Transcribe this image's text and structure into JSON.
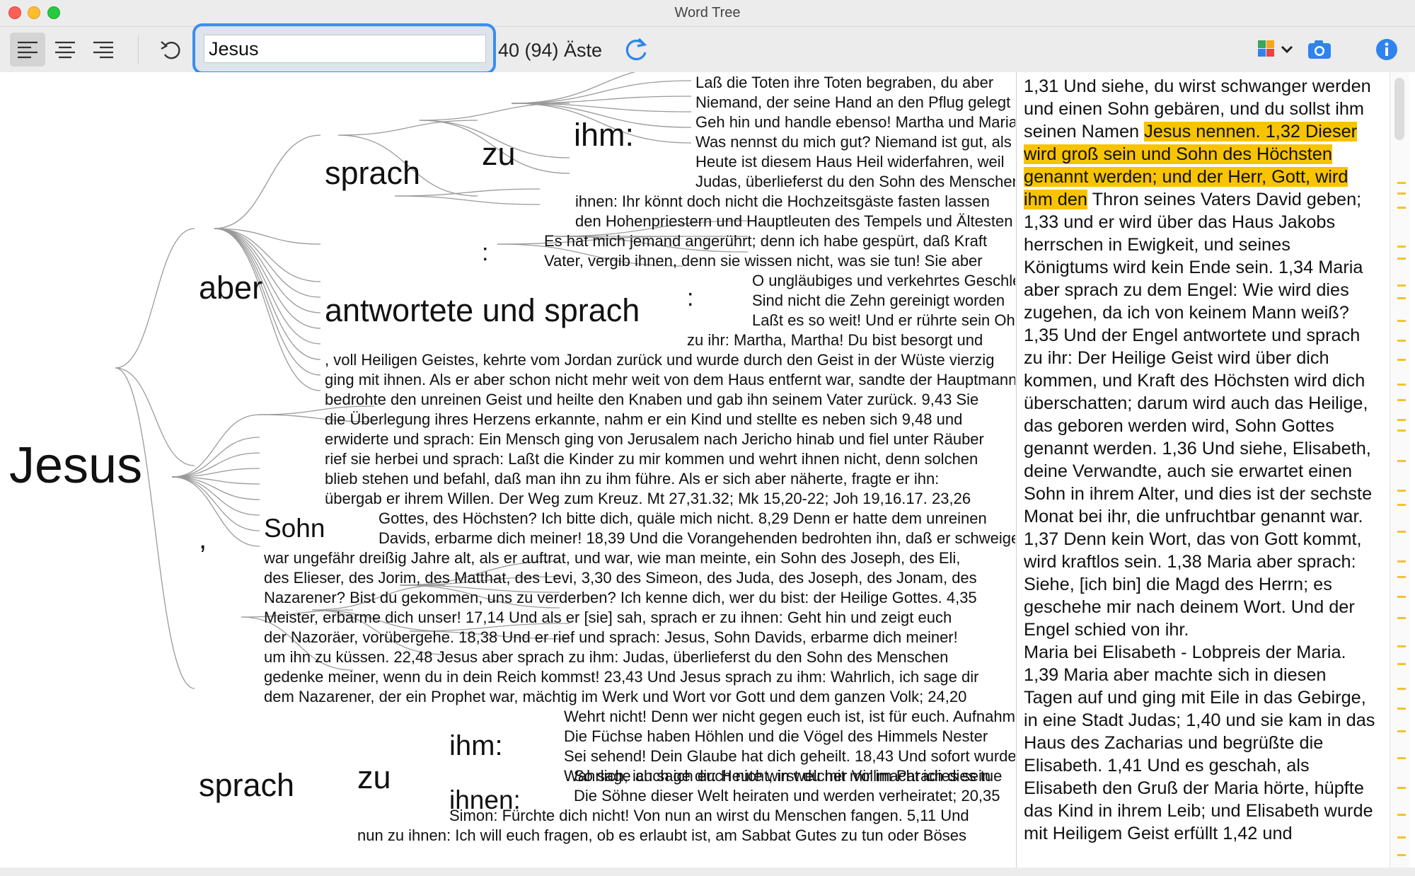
{
  "window": {
    "title": "Word Tree"
  },
  "toolbar": {
    "align_left": "align-left",
    "align_center": "align-center",
    "align_right": "align-right",
    "undo": "undo",
    "search_value": "Jesus",
    "branch_count": "40 (94) Äste",
    "refresh": "refresh",
    "palette": "color-palette",
    "screenshot": "camera",
    "info": "info"
  },
  "tree": {
    "root": "Jesus",
    "aber": "aber",
    "sprach_a": "sprach",
    "zu_a": "zu",
    "ihm_a": "ihm:",
    "colon_a": ":",
    "antw": "antwortete und sprach",
    "colon_b": ":",
    "comma": ",",
    "sohn": "Sohn",
    "sprach_b": "sprach",
    "zu_b": "zu",
    "ihm_b": "ihm:",
    "ihnen_b": "ihnen:",
    "g1": [
      "Laß die Toten ihre Toten begraben, du aber",
      "Niemand, der seine Hand an den Pflug gelegt",
      "Geh hin und handle ebenso! Martha und Maria",
      "Was nennst du mich gut? Niemand ist gut, als",
      "Heute ist diesem Haus Heil widerfahren, weil",
      "Judas, überlieferst du den Sohn des Menschen"
    ],
    "g2": [
      "ihnen: Ihr könnt doch nicht die Hochzeitsgäste fasten lassen",
      "den Hohenpriestern und Hauptleuten des Tempels und Ältesten"
    ],
    "g3": [
      "Es hat mich jemand angerührt; denn ich habe gespürt, daß Kraft",
      "Vater, vergib ihnen, denn sie wissen nicht, was sie tun! Sie aber"
    ],
    "g4": [
      "O ungläubiges und verkehrtes Geschlecht",
      "Sind nicht die Zehn gereinigt worden",
      "Laßt es so weit! Und er rührte sein Ohr"
    ],
    "g5": "zu ihr: Martha, Martha! Du bist besorgt und",
    "g6": [
      ", voll Heiligen Geistes, kehrte vom Jordan zurück und wurde durch den Geist in der Wüste vierzig",
      "ging mit ihnen. Als er aber schon nicht mehr weit von dem Haus entfernt war, sandte der Hauptmann",
      "bedrohte den unreinen Geist und heilte den Knaben und gab ihn seinem Vater zurück. 9,43 Sie",
      "die Überlegung ihres Herzens erkannte, nahm er ein Kind und stellte es neben sich 9,48 und",
      "erwiderte und sprach: Ein Mensch ging von Jerusalem nach Jericho hinab und fiel unter Räuber",
      "rief sie herbei und sprach: Laßt die Kinder zu mir kommen und wehrt ihnen nicht, denn solchen",
      "blieb stehen und befahl, daß man ihn zu ihm führe. Als er sich aber näherte, fragte er ihn:",
      "übergab er ihrem Willen. Der Weg zum Kreuz. Mt 27,31.32; Mk 15,20-22; Joh 19,16.17. 23,26"
    ],
    "g7": [
      "Gottes, des Höchsten? Ich bitte dich, quäle mich nicht. 8,29 Denn er hatte dem unreinen",
      "Davids, erbarme dich meiner! 18,39 Und die Vorangehenden bedrohten ihn, daß er schweige"
    ],
    "g8": [
      "war ungefähr dreißig Jahre alt, als er auftrat, und war, wie man meinte, ein Sohn des Joseph, des Eli,",
      "des Elieser, des Jorim, des Matthat, des Levi, 3,30 des Simeon, des Juda, des Joseph, des Jonam, des",
      "Nazarener? Bist du gekommen, uns zu verderben? Ich kenne dich, wer du bist: der Heilige Gottes. 4,35",
      "Meister, erbarme dich unser! 17,14 Und als er [sie] sah, sprach er zu ihnen: Geht hin und zeigt euch",
      "der Nazoräer, vorübergehe. 18,38 Und er rief und sprach: Jesus, Sohn Davids, erbarme dich meiner!",
      "um ihn zu küssen. 22,48 Jesus aber sprach zu ihm: Judas, überlieferst du den Sohn des Menschen",
      "gedenke meiner, wenn du in dein Reich kommst! 23,43 Und Jesus sprach zu ihm: Wahrlich, ich sage dir",
      "dem Nazarener, der ein Prophet war, mächtig im Werk und Wort vor Gott und dem ganzen Volk; 24,20"
    ],
    "g9": [
      "Wehrt nicht! Denn wer nicht gegen euch ist, ist für euch. Aufnahme",
      "Die Füchse haben Höhlen und die Vögel des Himmels Nester",
      "Sei sehend! Dein Glaube hat dich geheilt. 18,43 Und sofort wurde",
      "Wahrlich, ich sage dir: Heute wirst du mit mir im Paradies sein"
    ],
    "g10": [
      "So sage auch ich euch nicht, in welcher Vollmacht ich dies tue",
      "Die Söhne dieser Welt heiraten und werden verheiratet; 20,35"
    ],
    "g11": "Simon: Fürchte dich nicht! Von nun an wirst du Menschen fangen. 5,11 Und",
    "g12": "nun zu ihnen: Ich will euch fragen, ob es erlaubt ist, am Sabbat Gutes zu tun oder Böses"
  },
  "panel": {
    "pre": "1,31 Und siehe, du wirst schwanger werden und einen Sohn gebären, und du sollst ihm seinen Namen ",
    "highlight": "Jesus nennen. 1,32 Dieser wird groß sein und Sohn des Höchsten genannt werden; und der Herr, Gott, wird ihm den",
    "post": " Thron seines Vaters David geben; 1,33 und er wird über das Haus Jakobs herrschen in Ewigkeit, und seines Königtums wird kein Ende sein. 1,34 Maria aber sprach zu dem Engel: Wie wird dies zugehen, da ich von keinem Mann weiß? 1,35 Und der Engel antwortete und sprach zu ihr: Der Heilige Geist wird über dich kommen, und Kraft des Höchsten wird dich überschatten; darum wird auch das Heilige, das geboren werden wird, Sohn Gottes genannt werden. 1,36 Und siehe, Elisabeth, deine Verwandte, auch sie erwartet einen Sohn in ihrem Alter, und dies ist der sechste Monat bei ihr, die unfruchtbar genannt war. 1,37 Denn kein Wort, das von Gott kommt, wird kraftlos sein. 1,38 Maria aber sprach: Siehe, [ich bin] die Magd des Herrn; es geschehe mir nach deinem Wort. Und der Engel schied von ihr.",
    "section": "Maria bei Elisabeth - Lobpreis der Maria.",
    "post2": "1,39 Maria aber machte sich in diesen Tagen auf und ging mit Eile in das Gebirge, in eine Stadt Judas; 1,40 und sie kam in das Haus des Zacharias und begrüßte die Elisabeth. 1,41 Und es geschah, als Elisabeth den Gruß der Maria hörte, hüpfte das Kind in ihrem Leib; und Elisabeth wurde mit Heiligem Geist erfüllt 1,42 und"
  },
  "colors": {
    "highlight": "#f8c300",
    "accent": "#3b8ef0",
    "scroll_marker": "#f2c232"
  }
}
